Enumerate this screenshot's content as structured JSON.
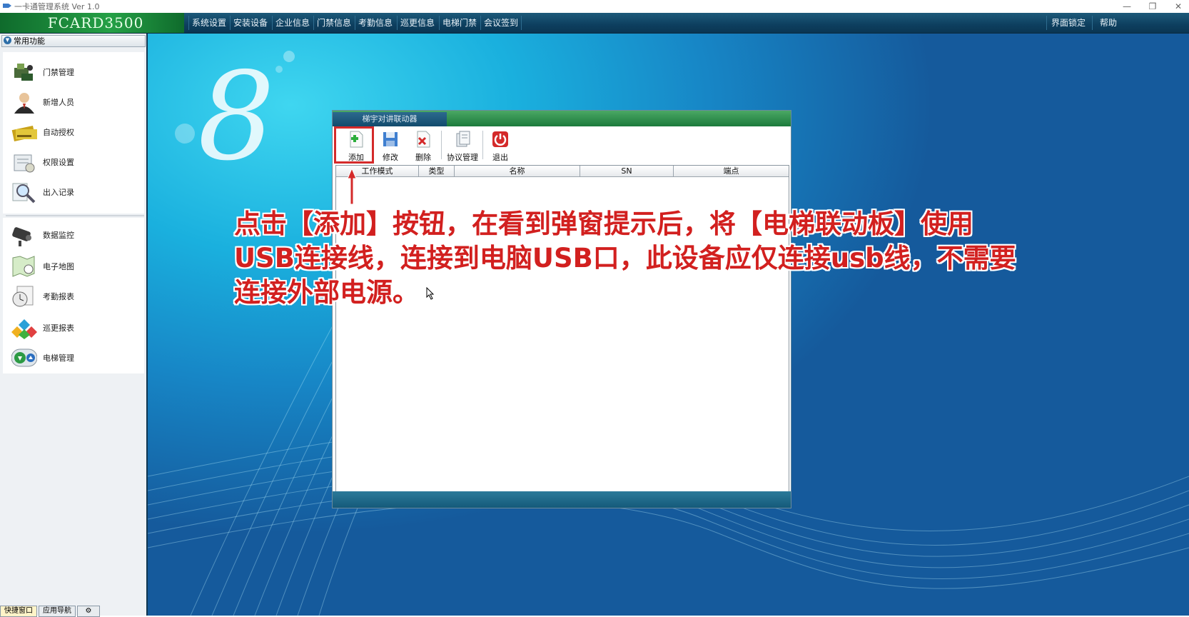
{
  "window": {
    "title": "一卡通管理系统  Ver 1.0",
    "controls": [
      "—",
      "❐",
      "✕"
    ]
  },
  "brand": {
    "name": "FCARD3500"
  },
  "menu": {
    "items": [
      "系统设置",
      "安装设备",
      "企业信息",
      "门禁信息",
      "考勤信息",
      "巡更信息",
      "电梯门禁",
      "会议签到"
    ],
    "right": [
      "界面锁定",
      "帮助"
    ]
  },
  "sidebar": {
    "header": "常用功能",
    "group1": [
      {
        "label": "门禁管理",
        "icon": "door-access-icon"
      },
      {
        "label": "新增人员",
        "icon": "person-icon"
      },
      {
        "label": "自动授权",
        "icon": "card-icon"
      },
      {
        "label": "权限设置",
        "icon": "permission-icon"
      },
      {
        "label": "出入记录",
        "icon": "magnifier-icon"
      }
    ],
    "group2": [
      {
        "label": "数据监控",
        "icon": "camera-icon"
      },
      {
        "label": "电子地图",
        "icon": "map-icon"
      },
      {
        "label": "考勤报表",
        "icon": "clock-report-icon"
      },
      {
        "label": "巡更报表",
        "icon": "patrol-icon"
      },
      {
        "label": "电梯管理",
        "icon": "elevator-icon"
      }
    ],
    "tabs": [
      "快捷窗口",
      "应用导航"
    ]
  },
  "dialog": {
    "tab": "梯宇对讲联动器",
    "toolbar": [
      {
        "label": "添加",
        "icon": "add-icon"
      },
      {
        "label": "修改",
        "icon": "save-icon"
      },
      {
        "label": "删除",
        "icon": "delete-icon"
      },
      {
        "label": "协议管理",
        "icon": "protocol-icon"
      },
      {
        "label": "退出",
        "icon": "power-icon"
      }
    ],
    "columns": [
      "工作模式",
      "类型",
      "名称",
      "SN",
      "端点"
    ]
  },
  "annotation": {
    "lines": [
      "点击【添加】按钮，在看到弹窗提示后，将【电梯联动板】使用",
      "USB连接线，连接到电脑USB口，此设备应仅连接usb线，不需要",
      "连接外部电源。"
    ]
  }
}
